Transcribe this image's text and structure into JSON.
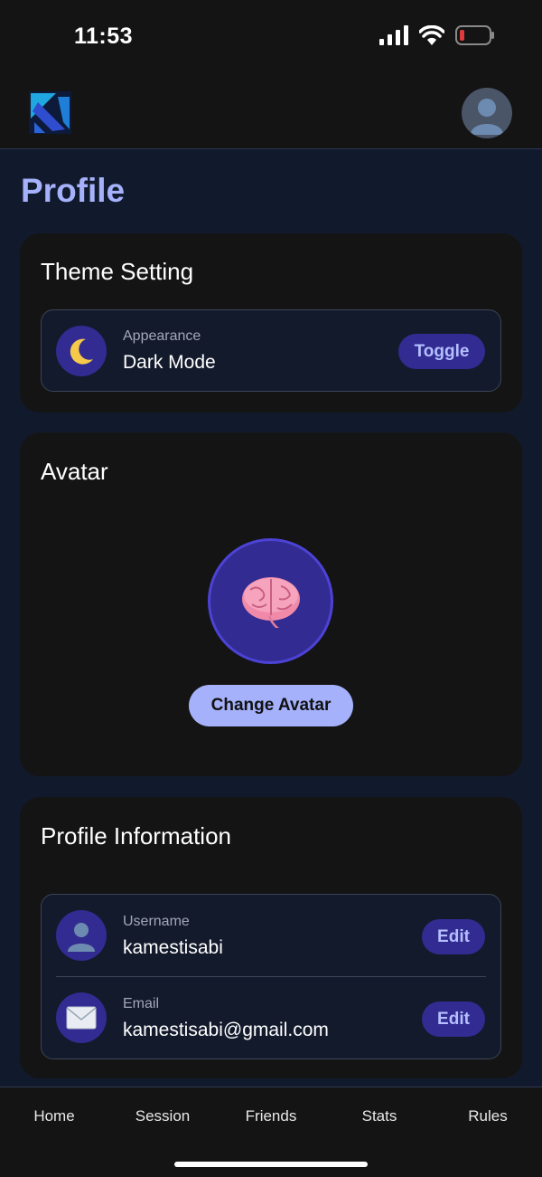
{
  "status_bar": {
    "time": "11:53"
  },
  "header": {
    "logo_icon": "app-logo-icon",
    "avatar_icon": "user-avatar-icon"
  },
  "page": {
    "title": "Profile"
  },
  "theme_card": {
    "title": "Theme Setting",
    "label": "Appearance",
    "value": "Dark Mode",
    "icon": "moon-icon",
    "button": "Toggle"
  },
  "avatar_card": {
    "title": "Avatar",
    "avatar_icon": "brain-icon",
    "button": "Change Avatar"
  },
  "profile_card": {
    "title": "Profile Information",
    "rows": [
      {
        "label": "Username",
        "value": "kamestisabi",
        "icon": "user-icon",
        "button": "Edit"
      },
      {
        "label": "Email",
        "value": "kamestisabi@gmail.com",
        "icon": "envelope-icon",
        "button": "Edit"
      }
    ]
  },
  "bottom_nav": {
    "items": [
      "Home",
      "Session",
      "Friends",
      "Stats",
      "Rules"
    ]
  },
  "colors": {
    "accent": "#a5b1fa",
    "button_bg": "#322b91",
    "card_bg": "#141414",
    "page_bg": "#111a2c"
  }
}
